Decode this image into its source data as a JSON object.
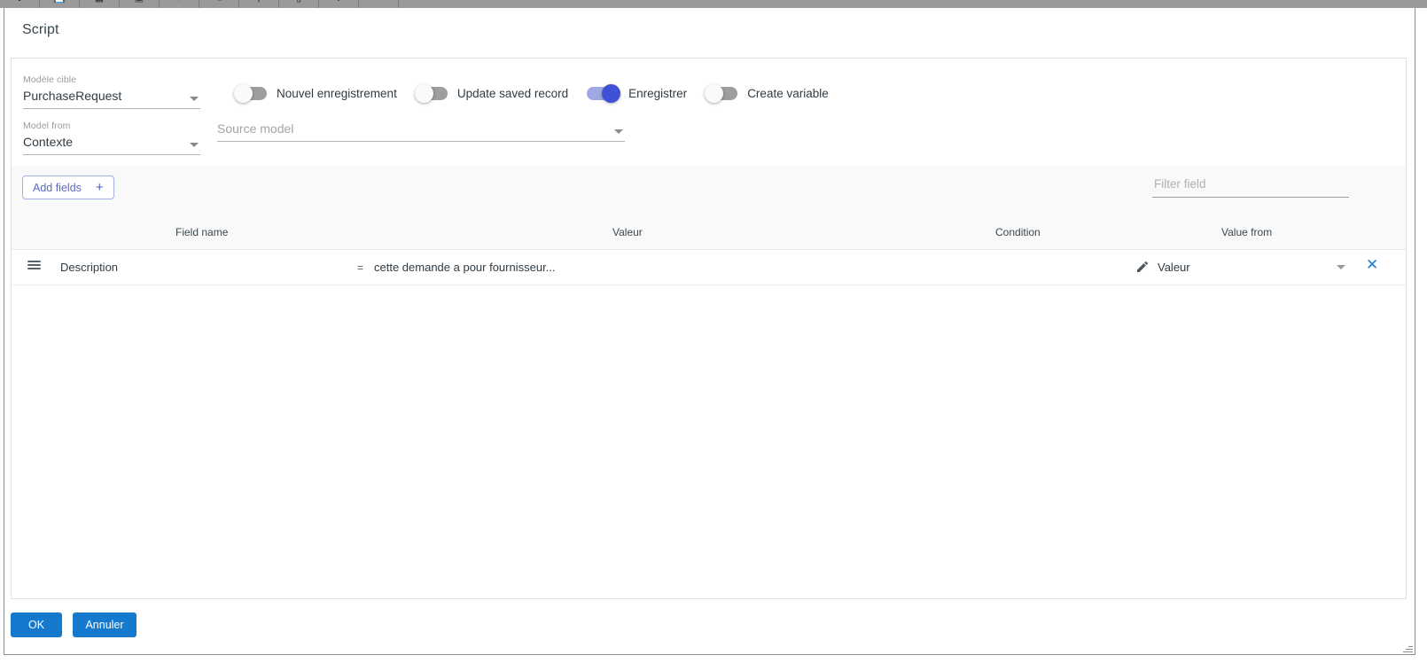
{
  "window": {
    "toolbar_icons": [
      "cursor-icon",
      "save-icon",
      "grid-icon",
      "image-icon",
      "chart-icon",
      "people-icon",
      "key-icon",
      "monitor-icon",
      "link-icon"
    ]
  },
  "dialog": {
    "title": "Script"
  },
  "form": {
    "target_model": {
      "label": "Modèle cible",
      "value": "PurchaseRequest"
    },
    "model_from": {
      "label": "Model from",
      "value": "Contexte"
    },
    "source_model": {
      "placeholder": "Source model",
      "value": ""
    },
    "toggles": [
      {
        "label": "Nouvel enregistrement",
        "on": false
      },
      {
        "label": "Update saved record",
        "on": false
      },
      {
        "label": "Enregistrer",
        "on": true
      },
      {
        "label": "Create variable",
        "on": false
      }
    ]
  },
  "grid": {
    "add_fields_label": "Add fields",
    "add_fields_plus": "+",
    "filter_placeholder": "Filter field",
    "filter_value": "",
    "columns": [
      "Field name",
      "Valeur",
      "Condition",
      "Value from"
    ],
    "rows": [
      {
        "field_name": "Description",
        "operator": "=",
        "value": "cette demande a pour fournisseur...",
        "condition": "",
        "value_from": "Valeur",
        "remove_label": "✕"
      }
    ]
  },
  "footer": {
    "ok_label": "OK",
    "cancel_label": "Annuler"
  },
  "colors": {
    "accent_blue": "#1579ce",
    "toggle_on_thumb": "#3f51d6",
    "toggle_on_track": "#9fa8e4",
    "outline_button": "#5c6bc0",
    "remove_x": "#1b7fd4"
  }
}
